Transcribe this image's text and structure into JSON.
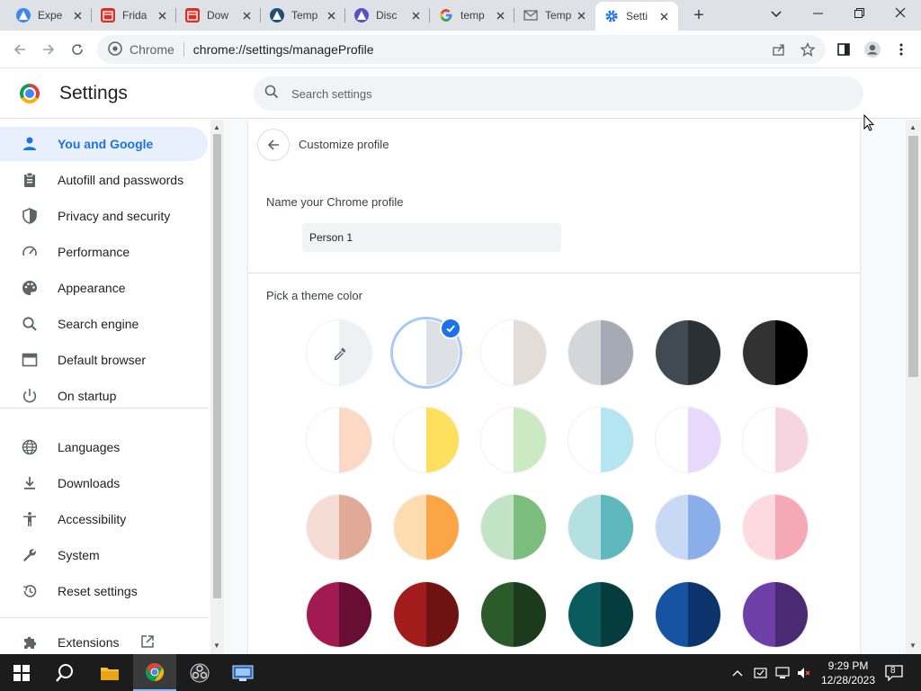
{
  "tabs": [
    {
      "title": "Expe",
      "icon": "app-icon",
      "color": "#4285f4"
    },
    {
      "title": "Frida",
      "icon": "calendar-icon",
      "color": "#d93025"
    },
    {
      "title": "Dow",
      "icon": "calendar-icon",
      "color": "#d93025"
    },
    {
      "title": "Temp",
      "icon": "app-icon",
      "color": "#1f4e79"
    },
    {
      "title": "Disc",
      "icon": "app-icon",
      "color": "#5b4fc9"
    },
    {
      "title": "temp",
      "icon": "google-icon",
      "color": "#4285f4"
    },
    {
      "title": "Temp",
      "icon": "mail-icon",
      "color": "#5f6368"
    },
    {
      "title": "Setti",
      "icon": "gear-icon",
      "color": "#1a73e8",
      "active": true
    }
  ],
  "omnibox": {
    "site_chip": "Chrome",
    "url": "chrome://settings/manageProfile"
  },
  "header": {
    "title": "Settings",
    "search_placeholder": "Search settings"
  },
  "sidebar": {
    "items": [
      {
        "label": "You and Google",
        "icon": "person-icon",
        "active": true
      },
      {
        "label": "Autofill and passwords",
        "icon": "clipboard-icon"
      },
      {
        "label": "Privacy and security",
        "icon": "shield-icon"
      },
      {
        "label": "Performance",
        "icon": "speedometer-icon"
      },
      {
        "label": "Appearance",
        "icon": "palette-icon"
      },
      {
        "label": "Search engine",
        "icon": "search-icon"
      },
      {
        "label": "Default browser",
        "icon": "browser-icon"
      },
      {
        "label": "On startup",
        "icon": "power-icon"
      },
      {
        "label": "Languages",
        "icon": "globe-icon"
      },
      {
        "label": "Downloads",
        "icon": "download-icon"
      },
      {
        "label": "Accessibility",
        "icon": "accessibility-icon"
      },
      {
        "label": "System",
        "icon": "wrench-icon"
      },
      {
        "label": "Reset settings",
        "icon": "history-icon"
      },
      {
        "label": "Extensions",
        "icon": "puzzle-icon"
      }
    ]
  },
  "main": {
    "title": "Customize profile",
    "name_label": "Name your Chrome profile",
    "name_value": "Person 1",
    "theme_label": "Pick a theme color",
    "swatches": [
      {
        "left": "#ffffff",
        "right": "#eef0f3",
        "picker": true
      },
      {
        "left": "#ffffff",
        "right": "#dde1e6",
        "selected": true
      },
      {
        "left": "#ffffff",
        "right": "#e3dcd7"
      },
      {
        "left": "#d4d6da",
        "right": "#a6aab4"
      },
      {
        "left": "#414a52",
        "right": "#2b3035"
      },
      {
        "left": "#323232",
        "right": "#000000"
      },
      {
        "left": "#ffffff",
        "right": "#fcd9c4"
      },
      {
        "left": "#ffffff",
        "right": "#ffdf5e"
      },
      {
        "left": "#ffffff",
        "right": "#cbeac4"
      },
      {
        "left": "#ffffff",
        "right": "#b3e6f1"
      },
      {
        "left": "#ffffff",
        "right": "#e8d8fb"
      },
      {
        "left": "#ffffff",
        "right": "#f6d5e1"
      },
      {
        "left": "#f5ddd6",
        "right": "#e1a998"
      },
      {
        "left": "#fddcb1",
        "right": "#fba546"
      },
      {
        "left": "#c3e3c6",
        "right": "#7bbd7d"
      },
      {
        "left": "#b4e0e1",
        "right": "#5fb8bd"
      },
      {
        "left": "#c8d9f5",
        "right": "#8aaeea"
      },
      {
        "left": "#fcdae0",
        "right": "#f7a8b6"
      },
      {
        "left": "#a11b52",
        "right": "#6a0d35"
      },
      {
        "left": "#a21c1c",
        "right": "#6f1212"
      },
      {
        "left": "#2b5b2b",
        "right": "#1c3a1c"
      },
      {
        "left": "#0b5b5e",
        "right": "#063c3e"
      },
      {
        "left": "#1753a3",
        "right": "#0c336b"
      },
      {
        "left": "#6f3fa8",
        "right": "#4a2a72"
      }
    ]
  },
  "taskbar": {
    "time": "9:29 PM",
    "date": "12/28/2023",
    "notifications": "8"
  }
}
